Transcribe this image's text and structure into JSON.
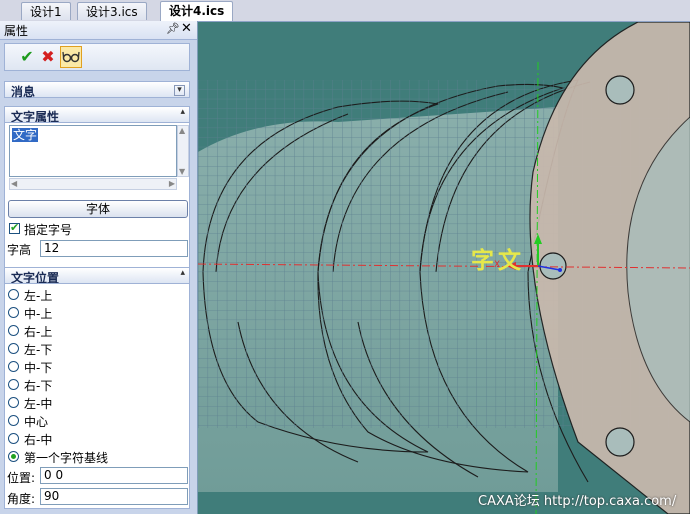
{
  "tabs": [
    {
      "label": "设计1",
      "active": false
    },
    {
      "label": "设计3.ics",
      "active": false
    },
    {
      "label": "设计4.ics",
      "active": true
    }
  ],
  "panel": {
    "title": "属性",
    "pin_icon": "pin-icon",
    "close_icon": "close-icon",
    "toolbar": {
      "ok_icon": "checkmark-icon",
      "cancel_icon": "cross-icon",
      "preview_icon": "glasses-icon"
    },
    "cancel_section": {
      "label": "消息"
    },
    "text_props": {
      "label": "文字属性",
      "text_value": "文字",
      "font_button": "字体",
      "specify_size_label": "指定字号",
      "specify_size_checked": true,
      "height_label": "字高",
      "height_value": "12"
    },
    "text_position": {
      "label": "文字位置",
      "options": [
        "左-上",
        "中-上",
        "右-上",
        "左-下",
        "中-下",
        "右-下",
        "左-中",
        "中心",
        "右-中",
        "第一个字符基线"
      ],
      "selected_index": 9,
      "position_label": "位置:",
      "position_value": "0 0",
      "angle_label": "角度:",
      "angle_value": "90"
    }
  },
  "viewport": {
    "overlay_text": "字文",
    "axis_marker": "X"
  },
  "watermark": "CAXA论坛 http://top.caxa.com/",
  "colors": {
    "viewport_bg": "#407d7a",
    "part_fill": "#c8d4d0",
    "flange_fill": "#c9b9ad",
    "axis_red": "#e03030",
    "axis_green": "#22cc22",
    "text_yellow": "#e6e84a"
  }
}
